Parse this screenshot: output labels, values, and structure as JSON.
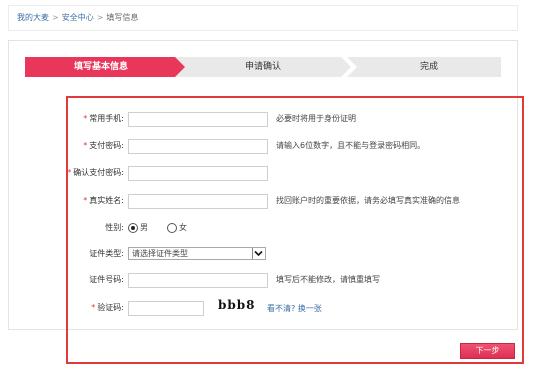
{
  "breadcrumb": {
    "items": [
      "我的大麦",
      "安全中心",
      "填写信息"
    ],
    "separator": ">"
  },
  "steps": [
    {
      "label": "填写基本信息",
      "active": true
    },
    {
      "label": "申请确认",
      "active": false
    },
    {
      "label": "完成",
      "active": false
    }
  ],
  "form": {
    "phone": {
      "label": "常用手机:",
      "required_mark": "*",
      "value": "",
      "hint": "必要时将用于身份证明"
    },
    "pay_password": {
      "label": "支付密码:",
      "required_mark": "*",
      "value": "",
      "hint": "请输入6位数字，且不能与登录密码相同。"
    },
    "confirm_pay_password": {
      "label": "确认支付密码:",
      "required_mark": "*",
      "value": ""
    },
    "real_name": {
      "label": "真实姓名:",
      "required_mark": "*",
      "value": "",
      "hint": "找回账户时的重要依据，请务必填写真实准确的信息"
    },
    "gender": {
      "label": "性别:",
      "options": [
        {
          "label": "男",
          "checked": true
        },
        {
          "label": "女",
          "checked": false
        }
      ]
    },
    "id_type": {
      "label": "证件类型:",
      "selected": "请选择证件类型"
    },
    "id_number": {
      "label": "证件号码:",
      "value": "",
      "hint": "填写后不能修改，请慎重填写"
    },
    "captcha": {
      "label": "验证码:",
      "required_mark": "*",
      "value": "",
      "image_text": "bbb8",
      "refresh_link": "看不清? 换一张"
    }
  },
  "next_button": "下一步",
  "colors": {
    "accent": "#e8375b",
    "highlight_border": "#e03a3a",
    "link": "#3a6ea5",
    "step_inactive": "#e9e9e9"
  }
}
